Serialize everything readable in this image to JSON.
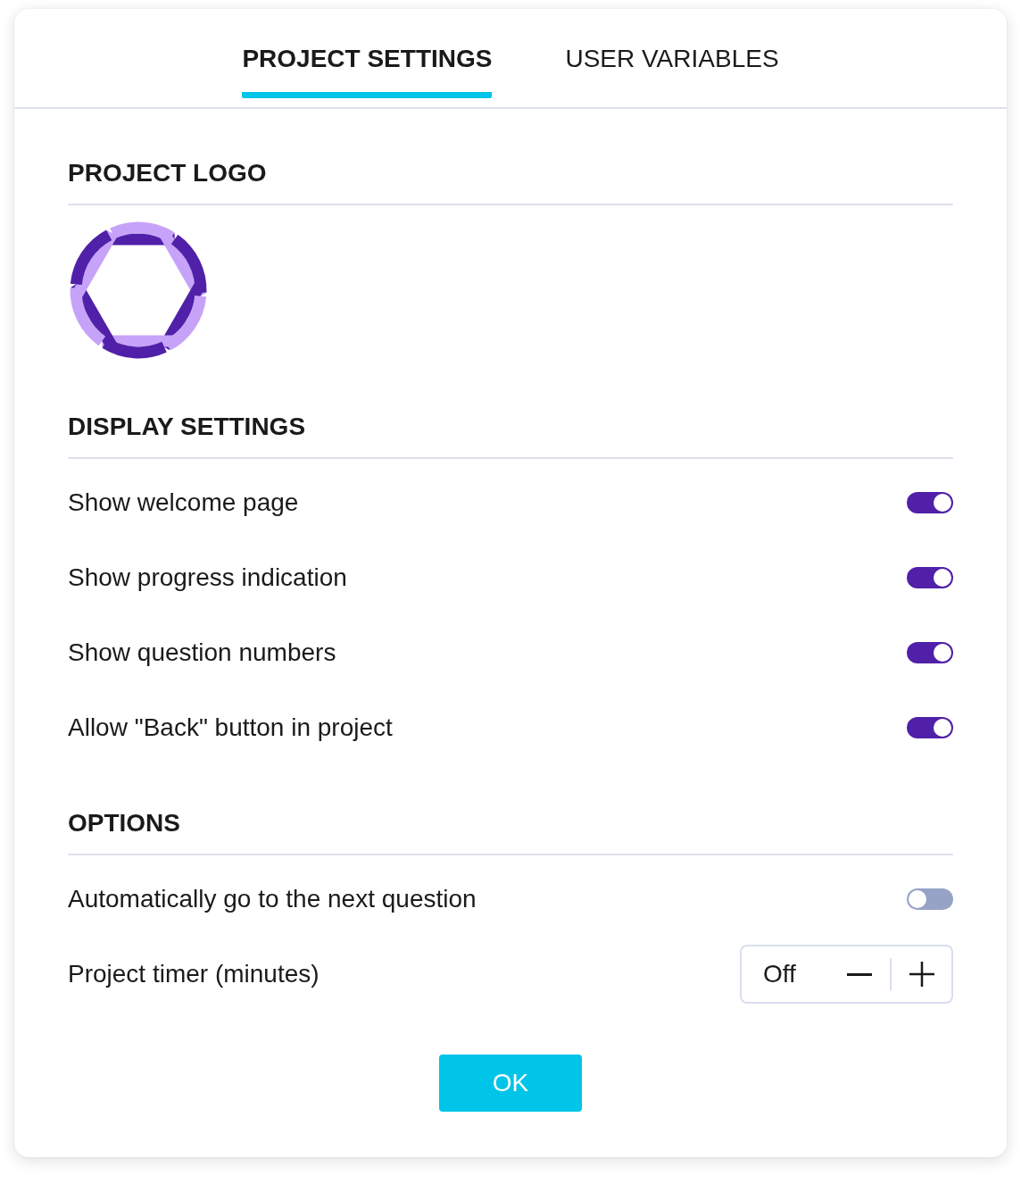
{
  "tabs": [
    {
      "label": "PROJECT SETTINGS",
      "selected": true
    },
    {
      "label": "USER VARIABLES",
      "selected": false
    }
  ],
  "project_logo": {
    "heading": "PROJECT LOGO"
  },
  "display_settings": {
    "heading": "DISPLAY SETTINGS",
    "items": [
      {
        "label": "Show welcome page",
        "on": true
      },
      {
        "label": "Show progress indication",
        "on": true
      },
      {
        "label": "Show question numbers",
        "on": true
      },
      {
        "label": "Allow \"Back\" button in project",
        "on": true
      }
    ]
  },
  "options": {
    "heading": "OPTIONS",
    "items": [
      {
        "kind": "toggle",
        "label": "Automatically go to the next question",
        "on": false
      },
      {
        "kind": "stepper",
        "label": "Project timer (minutes)",
        "value": "Off"
      }
    ]
  },
  "ok_button": "OK"
}
